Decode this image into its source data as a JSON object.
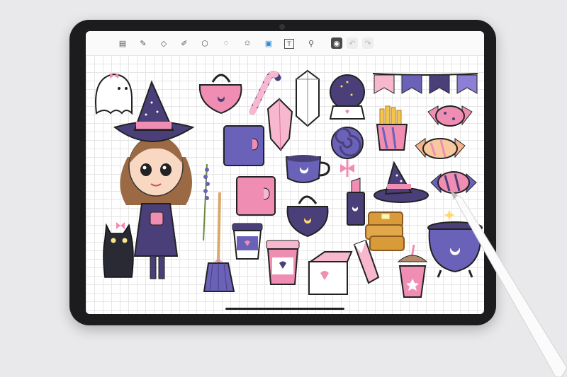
{
  "toolbar": {
    "tools": [
      {
        "name": "layers-icon",
        "glyph": "▤"
      },
      {
        "name": "pen-icon",
        "glyph": "✎"
      },
      {
        "name": "eraser-icon",
        "glyph": "◇"
      },
      {
        "name": "marker-icon",
        "glyph": "✐"
      },
      {
        "name": "shapes-icon",
        "glyph": "⬡"
      },
      {
        "name": "lasso-icon",
        "glyph": "◌"
      },
      {
        "name": "sticker-icon",
        "glyph": "☺"
      },
      {
        "name": "image-icon",
        "glyph": "▣"
      },
      {
        "name": "text-icon",
        "glyph": "T"
      },
      {
        "name": "pipette-icon",
        "glyph": "⚲"
      },
      {
        "name": "camera-icon",
        "glyph": "◉"
      },
      {
        "name": "undo-icon",
        "glyph": "↶"
      },
      {
        "name": "redo-icon",
        "glyph": "↷"
      }
    ]
  },
  "colors": {
    "purple_dark": "#4b3f7a",
    "purple_mid": "#6a62b8",
    "pink": "#f08db3",
    "pink_light": "#f7b7cf",
    "brown_hair": "#9b6a45",
    "gold": "#d99a3a"
  }
}
